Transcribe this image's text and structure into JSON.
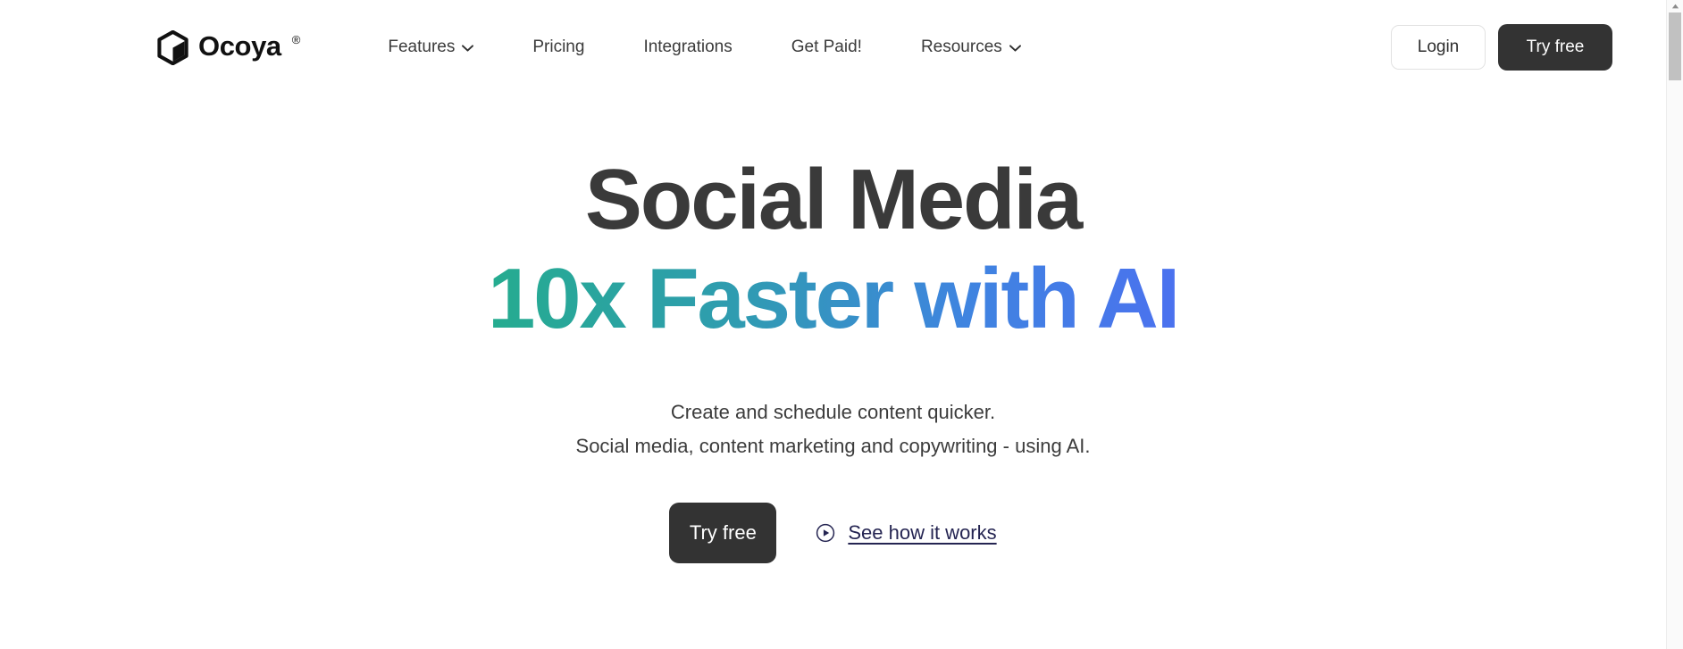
{
  "brand": {
    "name": "Ocoya",
    "registered_mark": "®",
    "logo_icon": "cube-logo-icon"
  },
  "nav": {
    "items": [
      {
        "label": "Features",
        "has_dropdown": true
      },
      {
        "label": "Pricing",
        "has_dropdown": false
      },
      {
        "label": "Integrations",
        "has_dropdown": false
      },
      {
        "label": "Get Paid!",
        "has_dropdown": false
      },
      {
        "label": "Resources",
        "has_dropdown": true
      }
    ]
  },
  "header_actions": {
    "login_label": "Login",
    "try_free_label": "Try free"
  },
  "hero": {
    "title_line1": "Social Media",
    "title_line2": "10x Faster with AI",
    "subtitle_line1": "Create and schedule content quicker.",
    "subtitle_line2": "Social media, content marketing and copywriting - using AI.",
    "cta_primary_label": "Try free",
    "video_link_label": "See how it works",
    "video_icon": "play-circle-icon"
  },
  "colors": {
    "page_background": "#ffffff",
    "headline_dark": "#3a3a3a",
    "gradient_start_green": "#1bb978",
    "gradient_mid_blue": "#3f84e0",
    "gradient_end_indigo": "#5a5ff6",
    "button_dark": "#333333",
    "link_navy": "#252552",
    "nav_text": "#3b3b3b"
  },
  "scrollbar": {
    "up_arrow_icon": "scroll-up-arrow-icon",
    "thumb": "scroll-thumb"
  }
}
